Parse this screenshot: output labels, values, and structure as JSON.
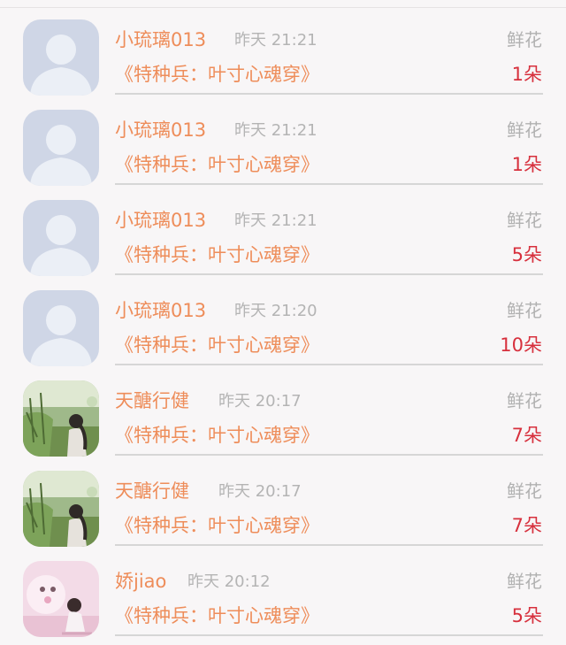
{
  "gift_list": {
    "items": [
      {
        "name": "小琉璃013",
        "time": "昨天 21:21",
        "gift": "鲜花",
        "book": "《特种兵：叶寸心魂穿》",
        "count": "1朵",
        "avatar": "default-user-icon"
      },
      {
        "name": "小琉璃013",
        "time": "昨天 21:21",
        "gift": "鲜花",
        "book": "《特种兵：叶寸心魂穿》",
        "count": "1朵",
        "avatar": "default-user-icon"
      },
      {
        "name": "小琉璃013",
        "time": "昨天 21:21",
        "gift": "鲜花",
        "book": "《特种兵：叶寸心魂穿》",
        "count": "5朵",
        "avatar": "default-user-icon"
      },
      {
        "name": "小琉璃013",
        "time": "昨天 21:20",
        "gift": "鲜花",
        "book": "《特种兵：叶寸心魂穿》",
        "count": "10朵",
        "avatar": "default-user-icon"
      },
      {
        "name": "天醣行健",
        "time": "昨天 20:17",
        "gift": "鲜花",
        "book": "《特种兵：叶寸心魂穿》",
        "count": "7朵",
        "avatar": "garden-photo"
      },
      {
        "name": "天醣行健",
        "time": "昨天 20:17",
        "gift": "鲜花",
        "book": "《特种兵：叶寸心魂穿》",
        "count": "7朵",
        "avatar": "garden-photo"
      },
      {
        "name": "娇jiao",
        "time": "昨天 20:12",
        "gift": "鲜花",
        "book": "《特种兵：叶寸心魂穿》",
        "count": "5朵",
        "avatar": "pink-photo"
      }
    ]
  },
  "colors": {
    "name": "#ee8d5a",
    "time": "#b4b4b4",
    "count": "#d7303d",
    "background": "#f8f6f7"
  }
}
